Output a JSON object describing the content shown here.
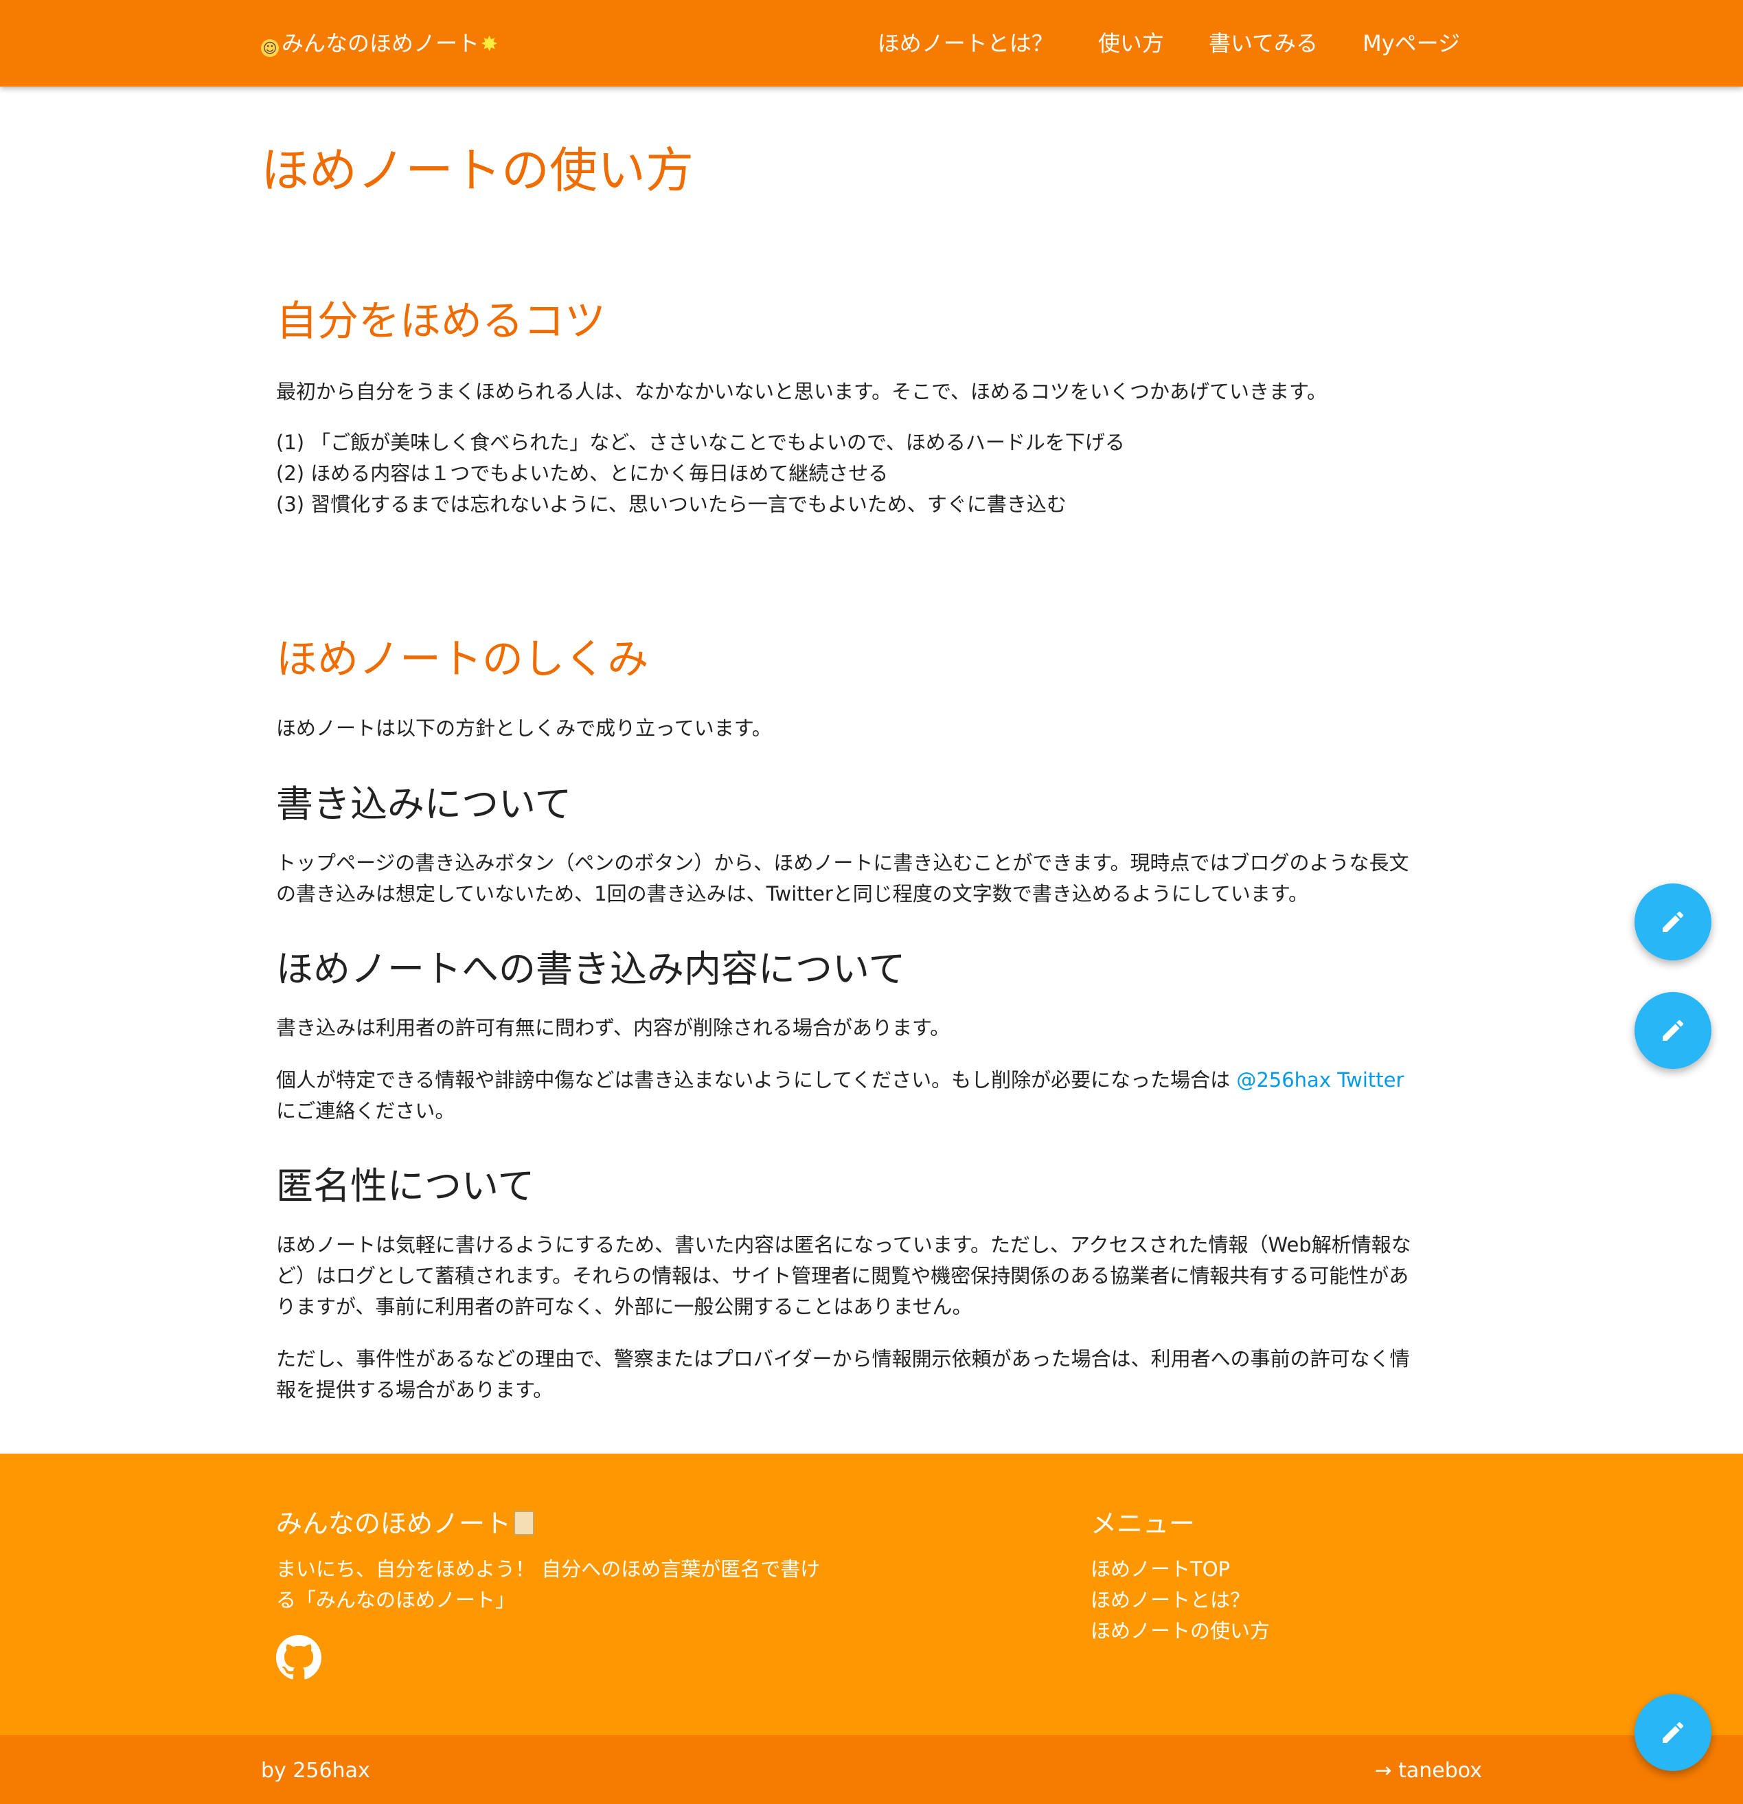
{
  "navbar": {
    "brand": "みんなのほめノート",
    "links": [
      "ほめノートとは？",
      "使い方",
      "書いてみる",
      "Myページ"
    ]
  },
  "page_title": "ほめノートの使い方",
  "tips": {
    "title": "自分をほめるコツ",
    "intro": "最初から自分をうまくほめられる人は、なかなかいないと思います。そこで、ほめるコツをいくつかあげていきます。",
    "items": [
      "(1) 「ご飯が美味しく食べられた」など、ささいなことでもよいので、ほめるハードルを下げる",
      "(2) ほめる内容は１つでもよいため、とにかく毎日ほめて継続させる",
      "(3) 習慣化するまでは忘れないように、思いついたら一言でもよいため、すぐに書き込む"
    ]
  },
  "mechanism": {
    "title": "ほめノートのしくみ",
    "intro": "ほめノートは以下の方針としくみで成り立っています。",
    "writing": {
      "title": "書き込みについて",
      "lines": [
        "トップページの書き込みボタン（ペンのボタン）から、ほめノートに書き込むことができます。現時点ではブログのような長文",
        "の書き込みは想定していないため、1回の書き込みは、Twitterと同じ程度の文字数で書き込めるようにしています。"
      ]
    },
    "content": {
      "title": "ほめノートへの書き込み内容について",
      "p1": "書き込みは利用者の許可有無に問わず、内容が削除される場合があります。",
      "p2_before": "個人が特定できる情報や誹謗中傷などは書き込まないようにしてください。もし削除が必要になった場合は ",
      "p2_link": "@256hax Twitter",
      "p2_after": "にご連絡ください。"
    },
    "anonymity": {
      "title": "匿名性について",
      "p1": [
        "ほめノートは気軽に書けるようにするため、書いた内容は匿名になっています。ただし、アクセスされた情報（Web解析情報な",
        "ど）はログとして蓄積されます。それらの情報は、サイト管理者に閲覧や機密保持関係のある協業者に情報共有する可能性があ",
        "りますが、事前に利用者の許可なく、外部に一般公開することはありません。"
      ],
      "p2": [
        "ただし、事件性があるなどの理由で、警察またはプロバイダーから情報開示依頼があった場合は、利用者への事前の許可なく情",
        "報を提供する場合があります。"
      ]
    }
  },
  "footer": {
    "title": "みんなのほめノート",
    "desc": [
      "まいにち、自分をほめよう！ 自分へのほめ言葉が匿名で書け",
      "る「みんなのほめノート」"
    ],
    "menu_title": "メニュー",
    "menu": [
      "ほめノートTOP",
      "ほめノートとは？",
      "ほめノートの使い方"
    ]
  },
  "bottom_bar": {
    "left": "by 256hax",
    "right": "→ tanebox"
  },
  "icons": {
    "brand_icons": [
      "smiling-face-icon",
      "glowing-star-icon"
    ],
    "fab": "pencil-icon",
    "footer_title": "book-icon",
    "footer_social": "github-icon"
  },
  "colors": {
    "navbar": "#f57c00",
    "heading": "#ef6c00",
    "footer": "#ff9800",
    "bottom_bar": "#f57c00",
    "fab": "#29b6f6",
    "link": "#039be5"
  }
}
